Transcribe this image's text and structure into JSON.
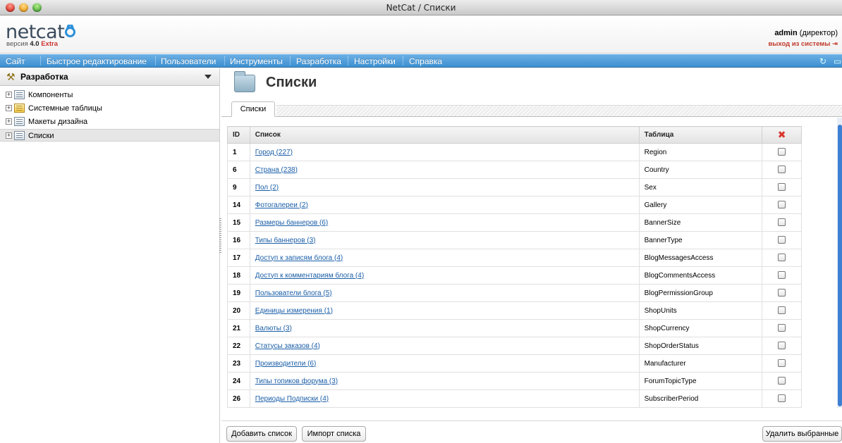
{
  "window": {
    "title": "NetCat / Списки"
  },
  "header": {
    "logo": "netcat",
    "version_prefix": "версия",
    "version_number": "4.0",
    "version_edition": "Extra",
    "user_name": "admin",
    "user_role": "(директор)",
    "logout_label": "выход из системы"
  },
  "menu": {
    "items": [
      "Сайт",
      "Быстрое редактирование",
      "Пользователи",
      "Инструменты",
      "Разработка",
      "Настройки",
      "Справка"
    ]
  },
  "sidebar": {
    "section_label": "Разработка",
    "items": [
      {
        "label": "Компоненты",
        "icon": "list-icon"
      },
      {
        "label": "Системные таблицы",
        "icon": "table-icon"
      },
      {
        "label": "Макеты дизайна",
        "icon": "list-icon"
      },
      {
        "label": "Списки",
        "icon": "list-icon",
        "selected": true
      }
    ]
  },
  "main": {
    "title": "Списки",
    "tab_label": "Списки",
    "columns": {
      "id": "ID",
      "name": "Список",
      "table": "Таблица"
    },
    "rows": [
      {
        "id": "1",
        "name": "Город (227)",
        "table": "Region"
      },
      {
        "id": "6",
        "name": "Страна (238)",
        "table": "Country"
      },
      {
        "id": "9",
        "name": "Пол (2)",
        "table": "Sex"
      },
      {
        "id": "14",
        "name": "Фотогалереи (2)",
        "table": "Gallery"
      },
      {
        "id": "15",
        "name": "Размеры баннеров (6)",
        "table": "BannerSize"
      },
      {
        "id": "16",
        "name": "Типы баннеров (3)",
        "table": "BannerType"
      },
      {
        "id": "17",
        "name": "Доступ к записям блога (4)",
        "table": "BlogMessagesAccess"
      },
      {
        "id": "18",
        "name": "Доступ к комментариям блога (4)",
        "table": "BlogCommentsAccess"
      },
      {
        "id": "19",
        "name": "Пользователи блога (5)",
        "table": "BlogPermissionGroup"
      },
      {
        "id": "20",
        "name": "Единицы измерения (1)",
        "table": "ShopUnits"
      },
      {
        "id": "21",
        "name": "Валюты (3)",
        "table": "ShopCurrency"
      },
      {
        "id": "22",
        "name": "Статусы заказов (4)",
        "table": "ShopOrderStatus"
      },
      {
        "id": "23",
        "name": "Производители (6)",
        "table": "Manufacturer"
      },
      {
        "id": "24",
        "name": "Типы топиков форума (3)",
        "table": "ForumTopicType"
      },
      {
        "id": "26",
        "name": "Периоды Подписки (4)",
        "table": "SubscriberPeriod"
      }
    ],
    "buttons": {
      "add": "Добавить список",
      "import": "Импорт списка",
      "delete": "Удалить выбранные"
    }
  },
  "colors": {
    "menu_bar": "#4f9ddc",
    "link": "#1a5ea8",
    "delete_icon": "#d9352c",
    "logout": "#c0392b"
  }
}
